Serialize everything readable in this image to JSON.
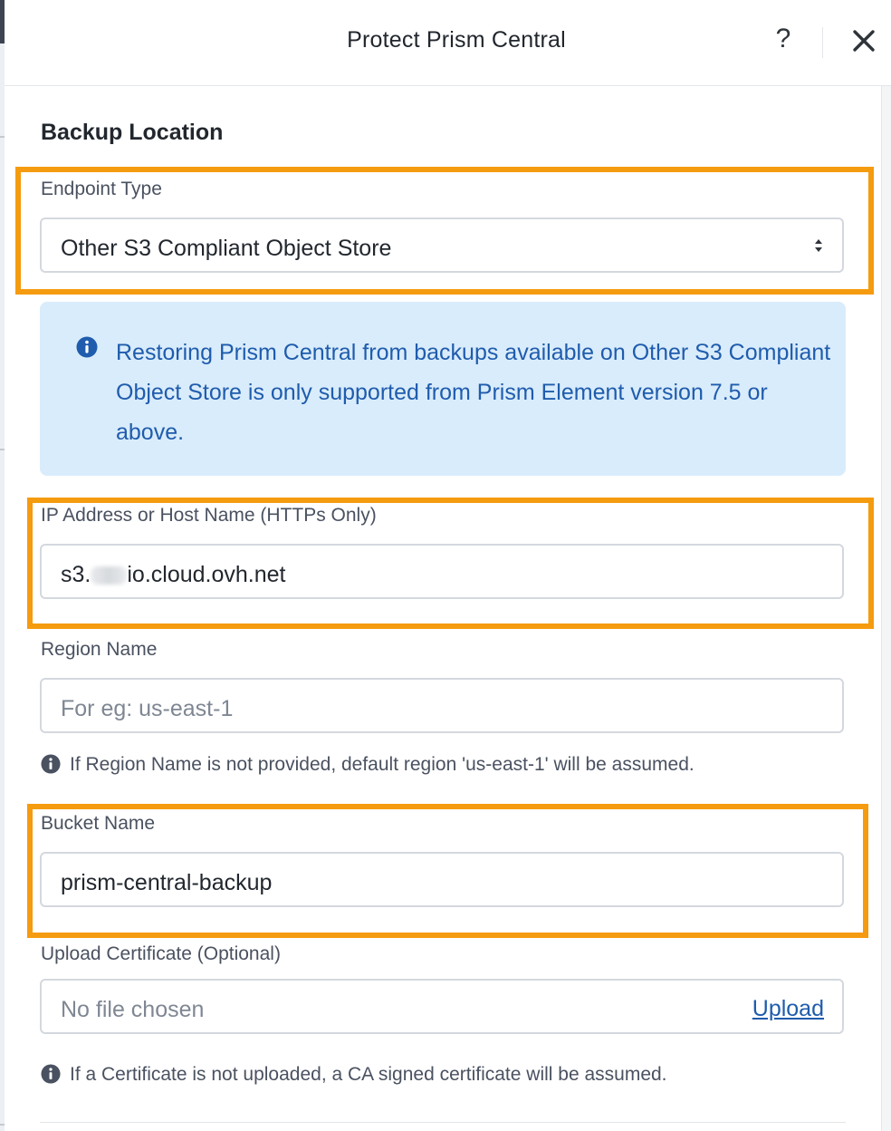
{
  "dialog": {
    "title": "Protect Prism Central",
    "help_label": "?"
  },
  "form": {
    "section_title": "Backup Location",
    "endpoint_type": {
      "label": "Endpoint Type",
      "value": "Other S3 Compliant Object Store"
    },
    "info_message": "Restoring Prism Central from backups available on Other S3 Compliant Object Store is only supported from Prism Element version 7.5 or above.",
    "host": {
      "label": "IP Address or Host Name (HTTPs Only)",
      "value_prefix": "s3.",
      "value_suffix": "io.cloud.ovh.net"
    },
    "region": {
      "label": "Region Name",
      "placeholder": "For eg: us-east-1",
      "hint": "If Region Name is not provided, default region 'us-east-1' will be assumed."
    },
    "bucket": {
      "label": "Bucket Name",
      "value": "prism-central-backup"
    },
    "certificate": {
      "label": "Upload Certificate (Optional)",
      "placeholder": "No file chosen",
      "upload_label": "Upload",
      "hint": "If a Certificate is not uploaded, a CA signed certificate will be assumed."
    }
  },
  "colors": {
    "highlight": "#f59b0f",
    "info_bg": "#d9ecfb",
    "info_text": "#1f5cad",
    "link": "#1f5cad"
  },
  "icons": [
    "help-icon",
    "close-icon",
    "select-arrows-icon",
    "info-icon"
  ]
}
